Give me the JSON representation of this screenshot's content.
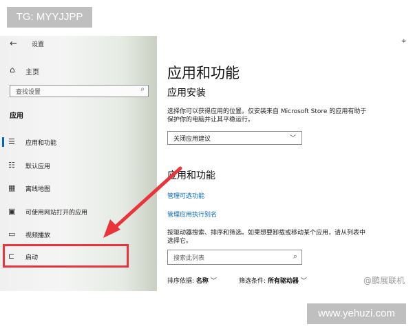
{
  "overlays": {
    "tg_label": "TG: MYYJJPP",
    "site_label": "www.yehuzi.com",
    "watermark": "@鹏展联机"
  },
  "sidebar": {
    "back_icon": "←",
    "title": "设置",
    "home_icon": "⌂",
    "home_label": "主页",
    "search_placeholder": "查找设置",
    "search_icon": "⌕",
    "section_label": "应用",
    "items": [
      {
        "icon": "☰",
        "label": "应用和功能",
        "selected": true
      },
      {
        "icon": "☷",
        "label": "默认应用",
        "selected": false
      },
      {
        "icon": "▦",
        "label": "离线地图",
        "selected": false
      },
      {
        "icon": "▣",
        "label": "可使用网站打开的应用",
        "selected": false
      },
      {
        "icon": "▭",
        "label": "视频播放",
        "selected": false
      },
      {
        "icon": "⊏",
        "label": "启动",
        "selected": false
      }
    ]
  },
  "main": {
    "more_icon": "⌖",
    "page_title": "应用和功能",
    "install_section_title": "应用安装",
    "install_description_line1": "选择你可以获得应用的位置。仅安装来自 Microsoft Store 的应用有助于",
    "install_description_line2": "保护你的电脑并让其平稳运行。",
    "install_dropdown_value": "关闭应用建议",
    "dropdown_chevron": "﹀",
    "apps_section_title": "应用和功能",
    "link_optional_features": "管理可选功能",
    "link_app_aliases": "管理应用执行别名",
    "list_description_line1": "按驱动器搜索、排序和筛选。如果想要卸载或移动某个应用，请从列表中",
    "list_description_line2": "选择它。",
    "list_search_placeholder": "搜索此列表",
    "list_search_icon": "⌕",
    "sort_label": "排序依据:",
    "sort_value": "名称",
    "filter_label": "筛选条件:",
    "filter_value": "所有驱动器",
    "filter_chevron": "﹀"
  },
  "colors": {
    "accent": "#0067c0",
    "highlight_red": "#e8343a"
  }
}
